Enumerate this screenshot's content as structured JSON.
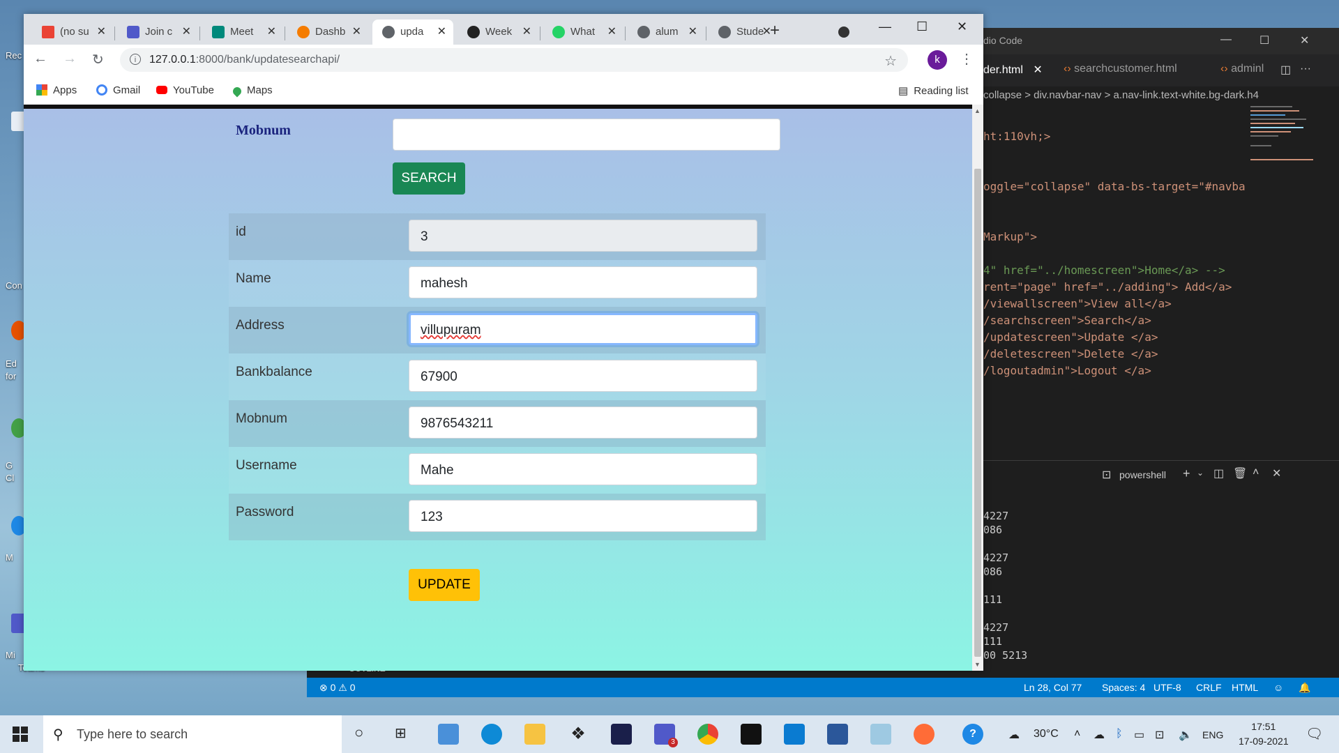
{
  "desktop": {
    "labels": [
      "Rec",
      "Con",
      "Ed",
      "for",
      "G",
      "Cl",
      "M",
      "Mi",
      "Teams"
    ]
  },
  "vscode": {
    "title": "dio Code",
    "tabs": [
      "der.html",
      "searchcustomer.html",
      "adminl"
    ],
    "breadcrumb": "collapse > div.navbar-nav > a.nav-link.text-white.bg-dark.h4",
    "code_lines": [
      "",
      "ht:110vh;>",
      "",
      "",
      "oggle=\"collapse\" data-bs-target=\"#navba",
      "",
      "",
      "Markup\">",
      "",
      "4\" href=\"../homescreen\">Home</a> -->",
      "rent=\"page\" href=\"../adding\"> Add</a>",
      "/viewallscreen\">View all</a>",
      "/searchscreen\">Search</a>",
      "/updatescreen\">Update </a>",
      "/deletescreen\">Delete </a>",
      "/logoutadmin\">Logout </a>"
    ],
    "terminal_name": "powershell",
    "terminal_lines": [
      "4227",
      "086",
      "",
      "4227",
      "086",
      "",
      "111",
      "",
      "4227",
      "111",
      "00 5213"
    ],
    "outline": "OUTLINE",
    "status": {
      "problems": "⊗ 0 ⚠ 0",
      "position": "Ln 28, Col 77",
      "spaces": "Spaces: 4",
      "encoding": "UTF-8",
      "eol": "CRLF",
      "language": "HTML"
    }
  },
  "browser": {
    "tabs": [
      {
        "label": "(no su",
        "color": "#ea4335"
      },
      {
        "label": "Join c",
        "color": "#5059c9"
      },
      {
        "label": "Meet",
        "color": "#00897b"
      },
      {
        "label": "Dashb",
        "color": "#f57c00"
      },
      {
        "label": "upda",
        "color": "#5f6368"
      },
      {
        "label": "Week",
        "color": "#222222"
      },
      {
        "label": "What",
        "color": "#25d366"
      },
      {
        "label": "alum",
        "color": "#5f6368"
      },
      {
        "label": "Stude",
        "color": "#5f6368"
      }
    ],
    "url_host": "127.0.0.1",
    "url_path": ":8000/bank/updatesearchapi/",
    "avatar_letter": "k",
    "bookmarks": [
      "Apps",
      "Gmail",
      "YouTube",
      "Maps"
    ],
    "reading_list": "Reading list"
  },
  "page": {
    "search_label": "Mobnum",
    "search_value": "",
    "search_button": "SEARCH",
    "fields": [
      {
        "label": "id",
        "value": "3"
      },
      {
        "label": "Name",
        "value": "mahesh"
      },
      {
        "label": "Address",
        "value": "villupuram"
      },
      {
        "label": "Bankbalance",
        "value": "67900"
      },
      {
        "label": "Mobnum",
        "value": "9876543211"
      },
      {
        "label": "Username",
        "value": "Mahe"
      },
      {
        "label": "Password",
        "value": "123"
      }
    ],
    "update_button": "UPDATE"
  },
  "taskbar": {
    "search_placeholder": "Type here to search",
    "weather": "30°C",
    "language": "ENG",
    "time": "17:51",
    "date": "17-09-2021",
    "teams_badge": "3"
  }
}
